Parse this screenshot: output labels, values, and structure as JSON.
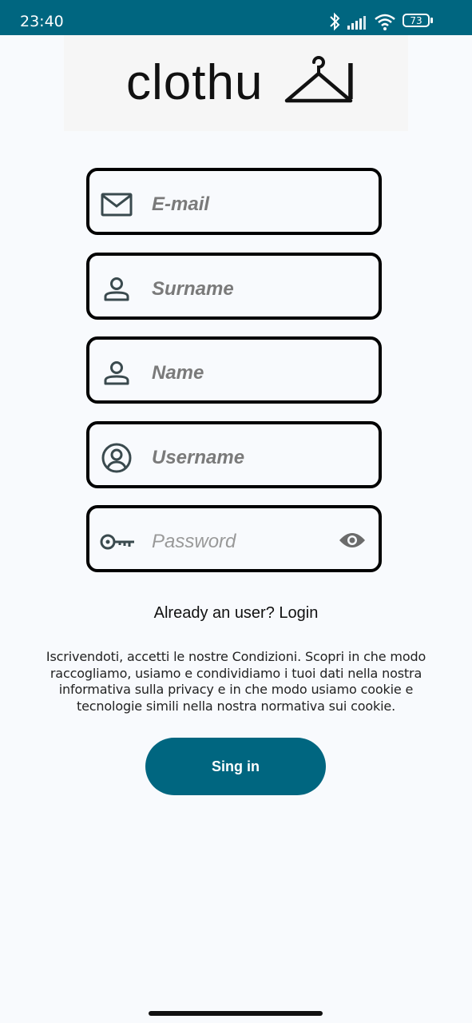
{
  "status_bar": {
    "time": "23:40",
    "battery": "73",
    "icons": [
      "bluetooth-icon",
      "signal-icon",
      "wifi-icon",
      "battery-icon"
    ]
  },
  "logo": {
    "text": "clothu",
    "end": "l",
    "icon": "hanger-icon"
  },
  "form": {
    "email": {
      "placeholder": "E-mail",
      "icon": "mail-icon"
    },
    "surname": {
      "placeholder": "Surname",
      "icon": "person-icon"
    },
    "name": {
      "placeholder": "Name",
      "icon": "person-icon"
    },
    "username": {
      "placeholder": "Username",
      "icon": "account-circle-icon"
    },
    "password": {
      "placeholder": "Password",
      "icon": "key-icon",
      "toggle_icon": "eye-icon"
    }
  },
  "login_link": "Already an user? Login",
  "terms": "Iscrivendoti, accetti le nostre Condizioni. Scopri in che modo raccogliamo, usiamo e condividiamo i tuoi dati nella nostra informativa sulla privacy e in che modo usiamo cookie e tecnologie simili nella nostra normativa sui cookie.",
  "signin_button": "Sing in",
  "colors": {
    "primary": "#006680",
    "background": "#f8fafd",
    "field_border": "#000000",
    "placeholder": "#7a7a7a"
  }
}
